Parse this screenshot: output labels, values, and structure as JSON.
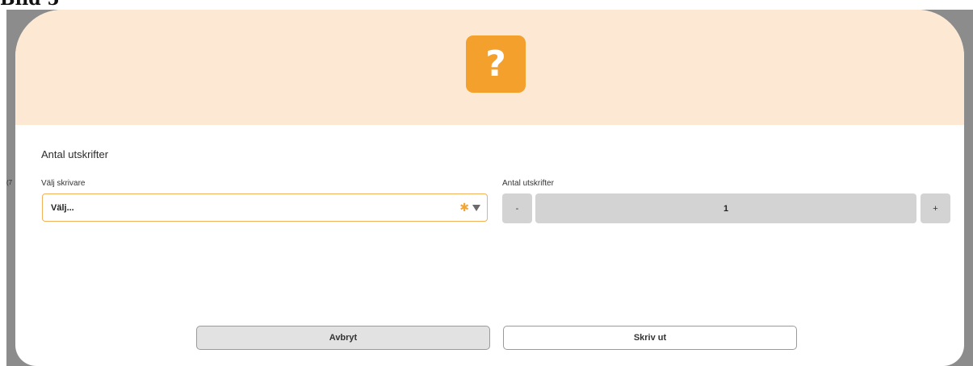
{
  "document": {
    "heading": "Bild 5"
  },
  "backdrop": {
    "edge_text": "(7"
  },
  "dialog": {
    "icon": "question-icon",
    "icon_glyph": "?",
    "section_title": "Antal utskrifter",
    "printer": {
      "label": "Välj skrivare",
      "value": "Välj...",
      "required_glyph": "✱",
      "required_icon": "asterisk-icon",
      "dropdown_icon": "caret-down-icon"
    },
    "copies": {
      "label": "Antal utskrifter",
      "decrement_label": "-",
      "value": "1",
      "increment_label": "+"
    },
    "buttons": {
      "cancel_label": "Avbryt",
      "print_label": "Skriv ut"
    }
  },
  "colors": {
    "header_background": "#fde9d3",
    "icon_background": "#f4a02d",
    "required_accent": "#f3a536",
    "select_border": "#f2b15a",
    "stepper_background": "#d3d3d3",
    "backdrop": "#8c8c8c"
  }
}
